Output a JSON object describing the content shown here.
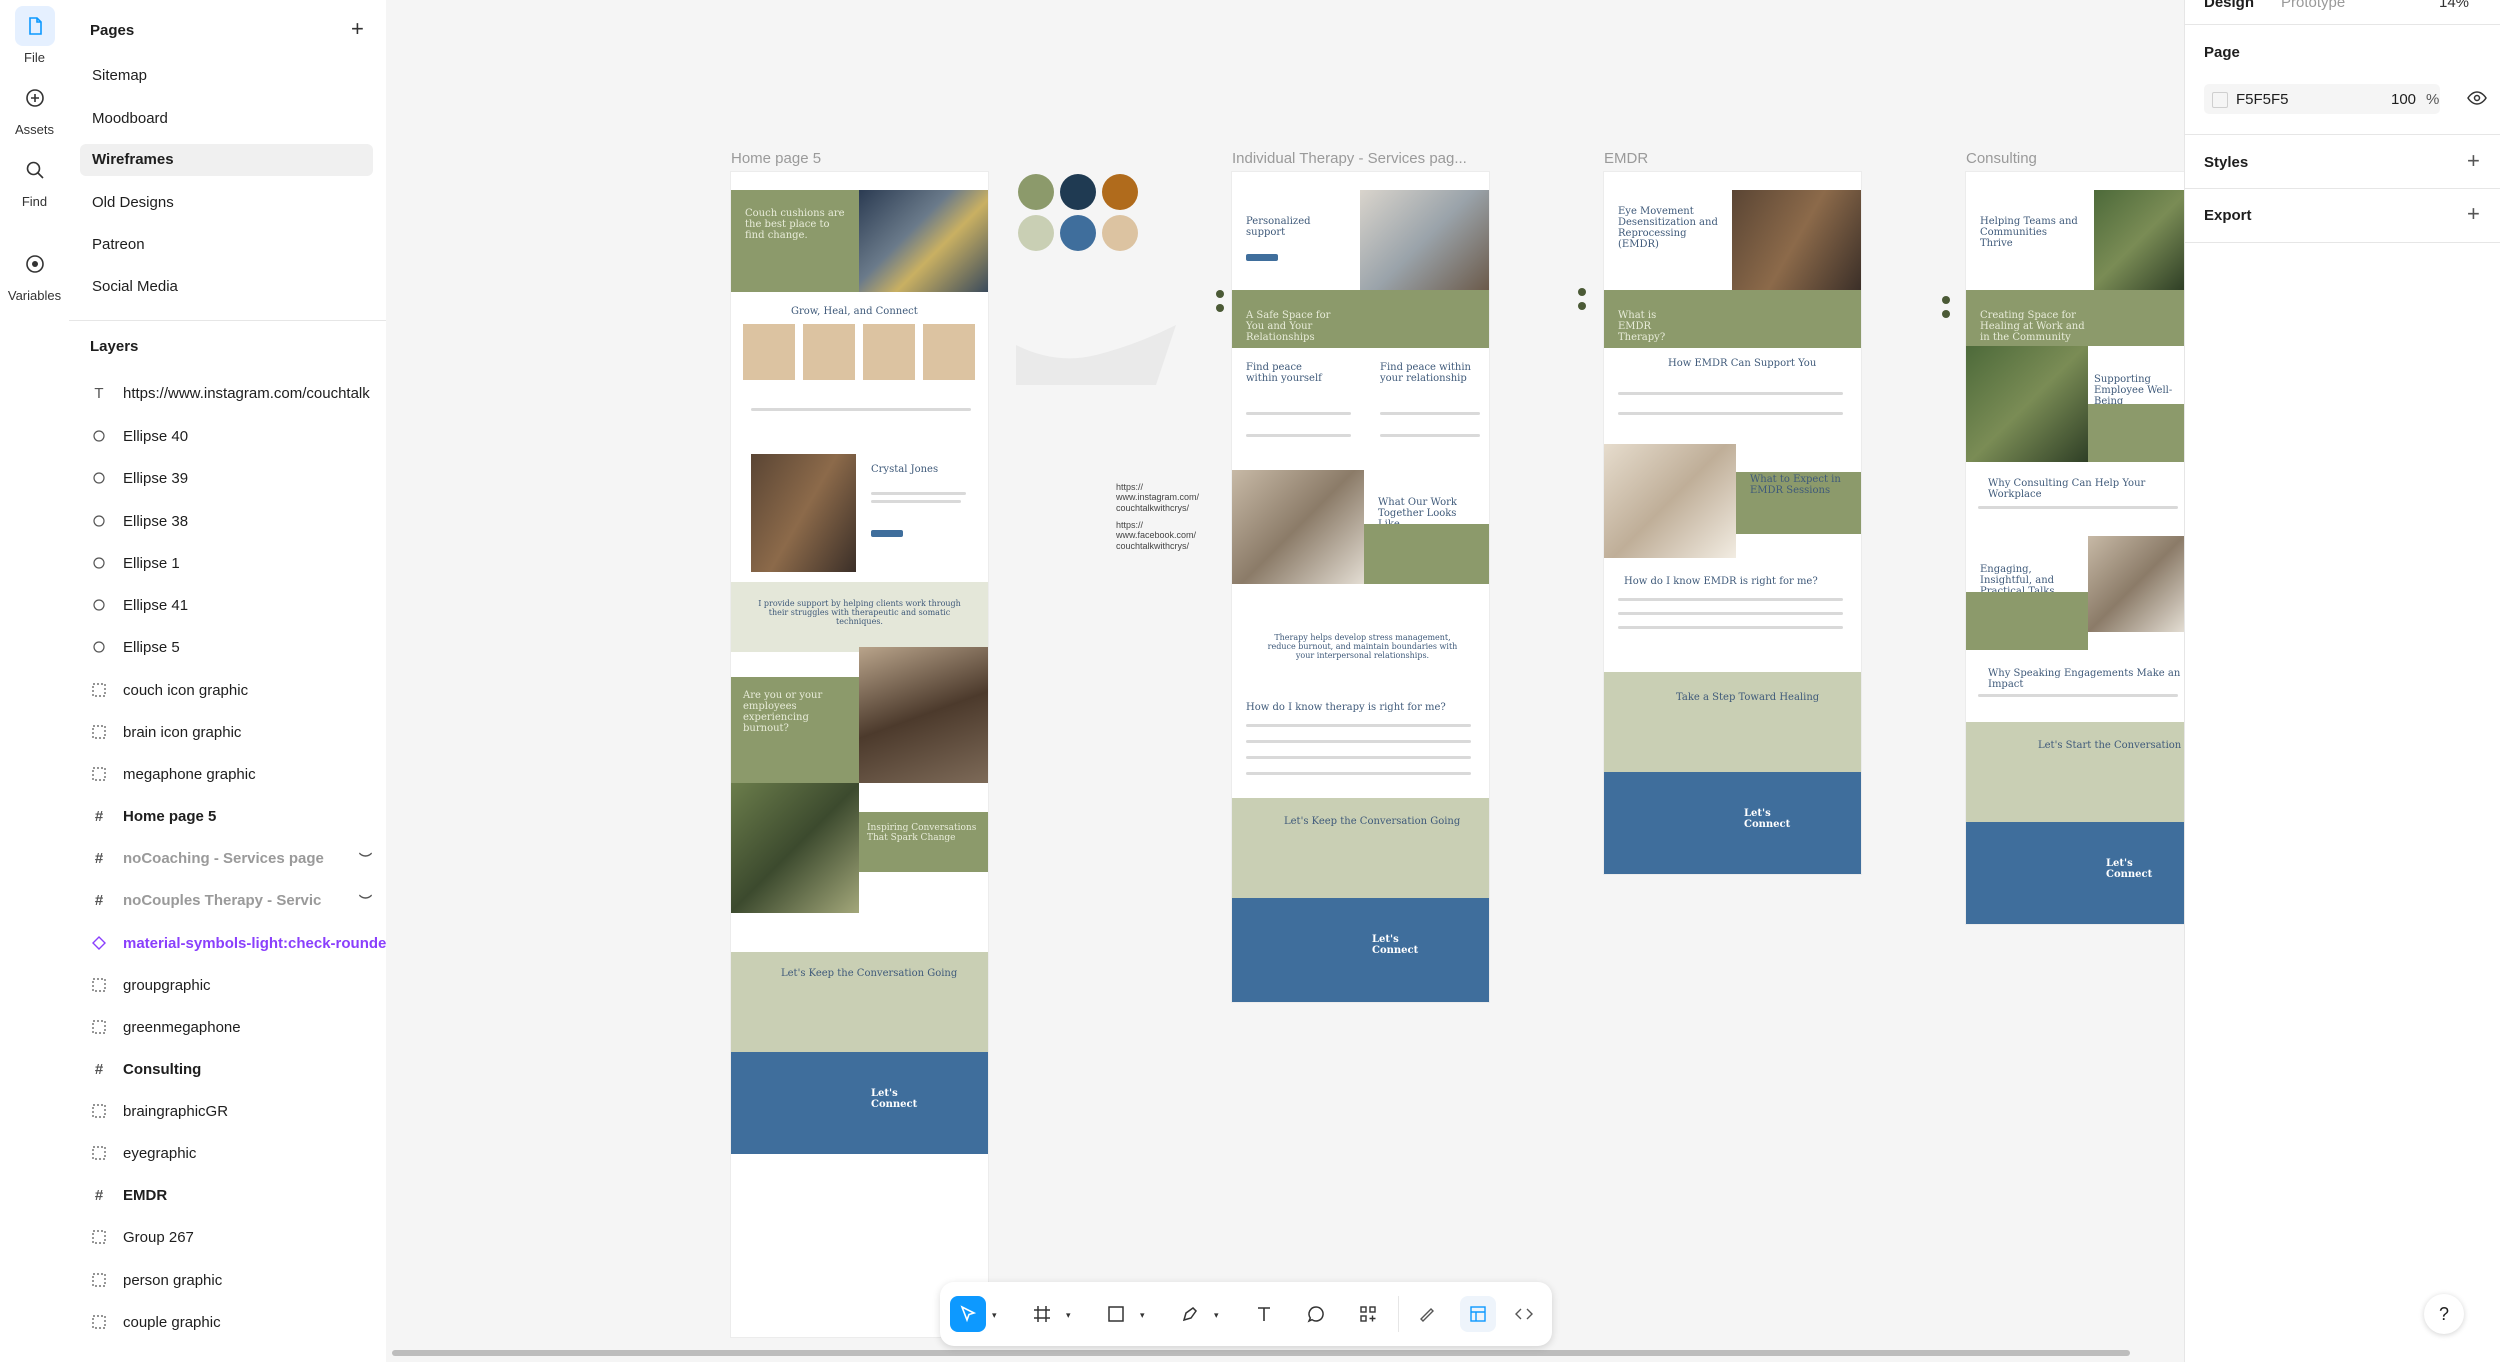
{
  "rail": {
    "items": [
      {
        "label": "File",
        "icon": "file-icon"
      },
      {
        "label": "Assets",
        "icon": "assets-icon"
      },
      {
        "label": "Find",
        "icon": "search-icon"
      },
      {
        "label": "Variables",
        "icon": "variables-icon"
      }
    ]
  },
  "pages": {
    "title": "Pages",
    "items": [
      "Sitemap",
      "Moodboard",
      "Wireframes",
      "Old Designs",
      "Patreon",
      "Social Media"
    ],
    "selected": "Wireframes"
  },
  "layers": {
    "title": "Layers",
    "items": [
      {
        "label": "https://www.instagram.com/couchtalk",
        "type": "text"
      },
      {
        "label": "Ellipse 40",
        "type": "ellipse"
      },
      {
        "label": "Ellipse 39",
        "type": "ellipse"
      },
      {
        "label": "Ellipse 38",
        "type": "ellipse"
      },
      {
        "label": "Ellipse 1",
        "type": "ellipse"
      },
      {
        "label": "Ellipse 41",
        "type": "ellipse"
      },
      {
        "label": "Ellipse 5",
        "type": "ellipse"
      },
      {
        "label": "couch icon graphic",
        "type": "group"
      },
      {
        "label": "brain icon graphic",
        "type": "group"
      },
      {
        "label": "megaphone graphic",
        "type": "group"
      },
      {
        "label": "Home page 5",
        "type": "frame"
      },
      {
        "label": "noCoaching - Services page",
        "type": "frame-hidden"
      },
      {
        "label": "noCouples Therapy - Servic",
        "type": "frame-hidden"
      },
      {
        "label": "material-symbols-light:check-rounde",
        "type": "component"
      },
      {
        "label": "groupgraphic",
        "type": "group"
      },
      {
        "label": "greenmegaphone",
        "type": "group"
      },
      {
        "label": "Consulting",
        "type": "frame"
      },
      {
        "label": "braingraphicGR",
        "type": "group"
      },
      {
        "label": "eyegraphic",
        "type": "group"
      },
      {
        "label": "EMDR",
        "type": "frame"
      },
      {
        "label": "Group 267",
        "type": "group"
      },
      {
        "label": "person graphic",
        "type": "group"
      },
      {
        "label": "couple graphic",
        "type": "group"
      }
    ]
  },
  "canvas": {
    "frames": [
      {
        "label": "Home page 5"
      },
      {
        "label": "Individual Therapy - Services pag..."
      },
      {
        "label": "EMDR"
      },
      {
        "label": "Consulting"
      }
    ],
    "swatches": [
      "#8c9a6b",
      "#1f3a52",
      "#b06b1c",
      "#c9cfb4",
      "#3f6e9c",
      "#dcc3a1"
    ],
    "home": {
      "hero": "Couch cushions are the best place to find change.",
      "grow": "Grow, Heal, and Connect",
      "name": "Crystal Jones",
      "quote": "I provide support by helping clients work through their struggles with therapeutic and somatic techniques.",
      "employees": "Are you or your employees experiencing burnout?",
      "inspiring": "Inspiring Conversations That Spark Change",
      "convo": "Let's Keep the Conversation Going",
      "connect": "Let's Connect"
    },
    "urls": {
      "instagram": "https:// www.instagram.com/ couchtalkwithcrys/",
      "facebook": "https:// www.facebook.com/ couchtalkwithcrys/"
    },
    "individual": {
      "hero": "Personalized support",
      "safe": "A Safe Space for You and Your Relationships",
      "peace1": "Find peace within yourself",
      "peace2": "Find peace within your relationship",
      "together": "What Our Work Together Looks Like",
      "therapy": "Therapy helps develop stress management, reduce burnout, and maintain boundaries with your interpersonal relationships.",
      "know": "How do I know therapy is right for me?",
      "convo": "Let's Keep the Conversation Going",
      "connect": "Let's Connect"
    },
    "emdr": {
      "hero": "Eye Movement Desensitization and Reprocessing (EMDR)",
      "what": "What is EMDR Therapy?",
      "how": "How EMDR Can Support You",
      "expect": "What to Expect in EMDR Sessions",
      "know": "How do I know EMDR is right for me?",
      "step": "Take a Step Toward Healing",
      "connect": "Let's Connect"
    },
    "consulting": {
      "hero": "Helping Teams and Communities Thrive",
      "creating": "Creating Space for Healing at Work and in the Community",
      "supporting": "Supporting Employee Well-Being",
      "why": "Why Consulting Can Help Your Workplace",
      "engaging": "Engaging, Insightful, and Practical Talks",
      "speaking": "Why Speaking Engagements Make an Impact",
      "start": "Let's Start the Conversation",
      "connect": "Let's Connect"
    }
  },
  "right_panel": {
    "tabs": [
      "Design",
      "Prototype"
    ],
    "zoom": "14%",
    "page_title": "Page",
    "page_color": "F5F5F5",
    "opacity": "100",
    "opacity_unit": "%",
    "styles": "Styles",
    "export": "Export"
  },
  "help": "?"
}
